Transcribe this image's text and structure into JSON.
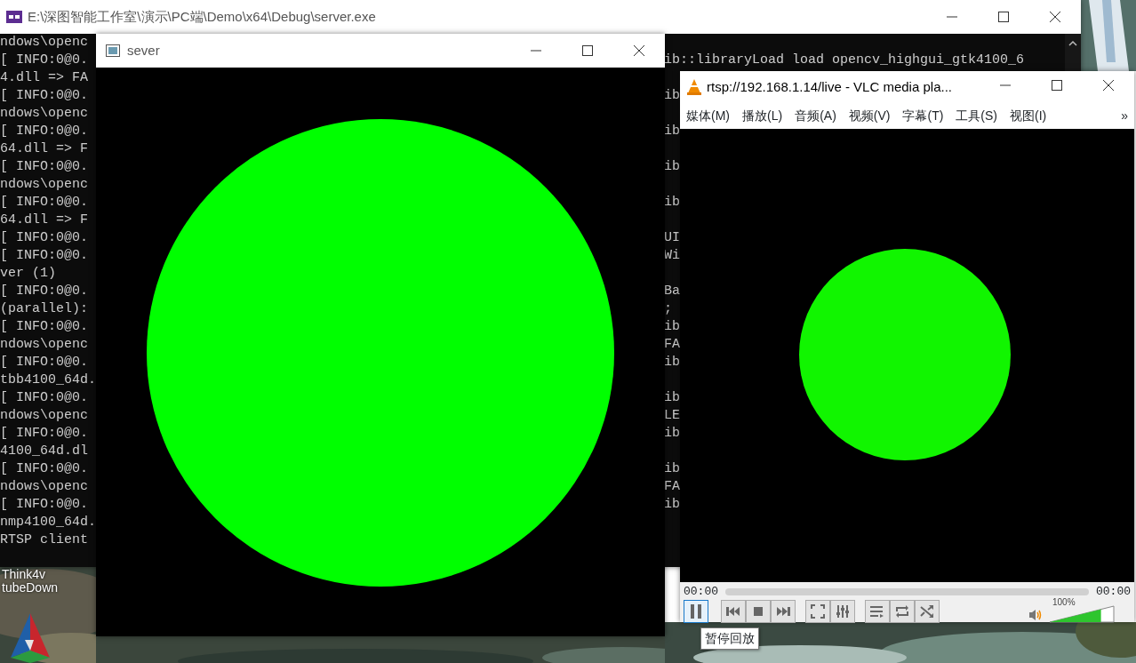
{
  "console": {
    "title": "E:\\深图智能工作室\\演示\\PC端\\Demo\\x64\\Debug\\server.exe",
    "lines": [
      {
        "left": "ndows\\openc"
      },
      {
        "left": "[ INFO:0@0.",
        "right": "ib::libraryLoad load opencv_highgui_gtk4100_6"
      },
      {
        "left": "4.dll => FA"
      },
      {
        "left": "[ INFO:0@0.",
        "right": "ib"
      },
      {
        "left": "ndows\\openc"
      },
      {
        "left": "[ INFO:0@0.",
        "right": "ib"
      },
      {
        "left": "64.dll => F"
      },
      {
        "left": "[ INFO:0@0.",
        "right": "ib"
      },
      {
        "left": "ndows\\openc"
      },
      {
        "left": "[ INFO:0@0.",
        "right": "ib"
      },
      {
        "left": "64.dll => F"
      },
      {
        "left": "[ INFO:0@0.",
        "right": "UI"
      },
      {
        "left": "[ INFO:0@0.",
        "right": "Wi"
      },
      {
        "left": "ver (1)"
      },
      {
        "left": "[ INFO:0@0.",
        "right": "Ba"
      },
      {
        "left": "(parallel):",
        "right": ";"
      },
      {
        "left": "[ INFO:0@0.",
        "right": "ib"
      },
      {
        "left": "ndows\\openc",
        "right": "FA"
      },
      {
        "left": "[ INFO:0@0.",
        "right": "ib"
      },
      {
        "left": "tbb4100_64d."
      },
      {
        "left": "[ INFO:0@0.",
        "right": "ib"
      },
      {
        "left": "ndows\\openc",
        "right": "LE"
      },
      {
        "left": "[ INFO:0@0.",
        "right": "ib"
      },
      {
        "left": "4100_64d.dl"
      },
      {
        "left": "[ INFO:0@0.",
        "right": "ib"
      },
      {
        "left": "ndows\\openc",
        "right": "FA"
      },
      {
        "left": "[ INFO:0@0.",
        "right": "ib"
      },
      {
        "left": "nmp4100_64d."
      },
      {
        "left": "RTSP client"
      }
    ]
  },
  "image_window": {
    "title": "sever"
  },
  "vlc": {
    "title": "rtsp://192.168.1.14/live - VLC media pla...",
    "menu": [
      "媒体(M)",
      "播放(L)",
      "音频(A)",
      "视频(V)",
      "字幕(T)",
      "工具(S)",
      "视图(I)"
    ],
    "more": "»",
    "elapsed": "00:00",
    "duration": "00:00",
    "pause_focused": true,
    "volume": {
      "reading": "100%",
      "level": 0.8
    },
    "tooltip": "暂停回放"
  },
  "desktop_icons": [
    {
      "label": "Think4v"
    },
    {
      "label": "tubeDown"
    }
  ]
}
